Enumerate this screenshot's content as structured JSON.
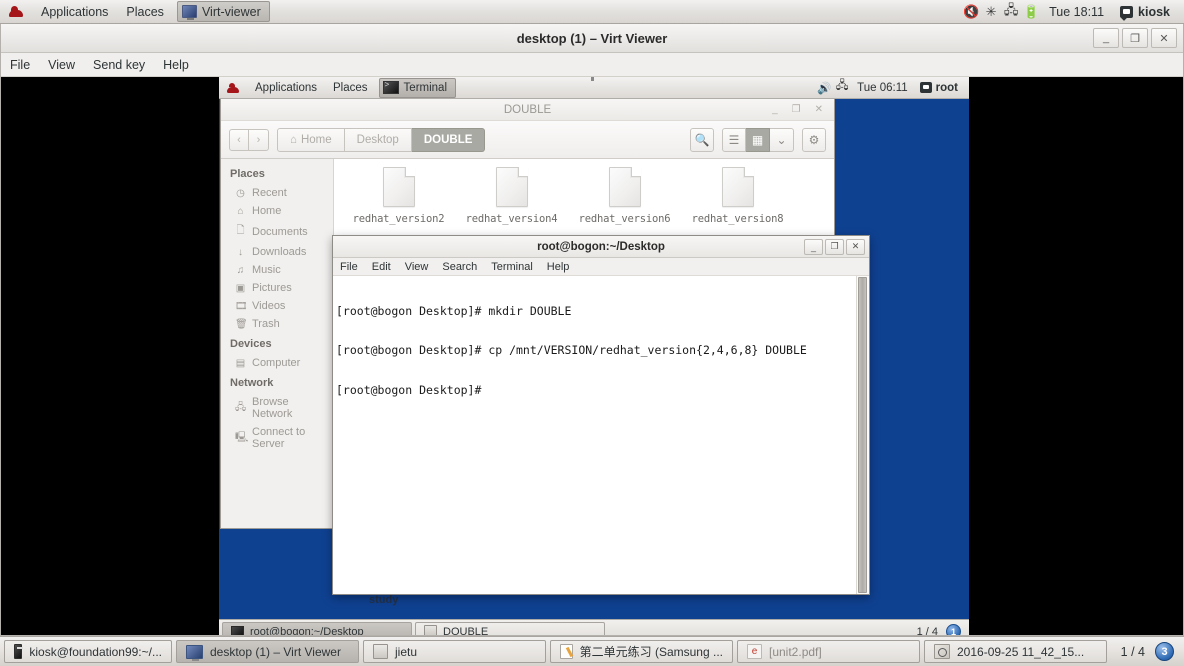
{
  "host_panel": {
    "logo": "redhat-logo",
    "applications": "Applications",
    "places": "Places",
    "active_task": "Virt-viewer",
    "tray": [
      "volume-muted-icon",
      "bluetooth-icon",
      "network-disconnected-icon",
      "battery-icon"
    ],
    "clock": "Tue 18:11",
    "user": "kiosk"
  },
  "virt_viewer": {
    "title": "desktop (1) – Virt Viewer",
    "window_buttons": {
      "minimize": "_",
      "maximize": "❐",
      "close": "✕"
    },
    "menu": [
      "File",
      "View",
      "Send key",
      "Help"
    ]
  },
  "guest_panel": {
    "applications": "Applications",
    "places": "Places",
    "active_task": "Terminal",
    "tray": [
      "volume-icon",
      "network-disconnected-icon"
    ],
    "clock": "Tue 06:11",
    "user": "root"
  },
  "file_manager": {
    "title": "DOUBLE",
    "window_buttons": {
      "minimize": "_",
      "maximize": "❐",
      "close": "✕"
    },
    "nav": {
      "back": "‹",
      "forward": "›"
    },
    "breadcrumbs": [
      {
        "label": "Home",
        "icon": "home-icon",
        "active": false
      },
      {
        "label": "Desktop",
        "icon": "",
        "active": false
      },
      {
        "label": "DOUBLE",
        "icon": "",
        "active": true
      }
    ],
    "toolbar_icons": {
      "search": "🔍",
      "list_view": "☰",
      "grid_view": "▦",
      "view_menu": "⌄",
      "settings": "⚙"
    },
    "sidebar": [
      {
        "type": "header",
        "label": "Places"
      },
      {
        "type": "item",
        "label": "Recent",
        "icon": "clock-icon"
      },
      {
        "type": "item",
        "label": "Home",
        "icon": "home-icon"
      },
      {
        "type": "item",
        "label": "Documents",
        "icon": "document-icon"
      },
      {
        "type": "item",
        "label": "Downloads",
        "icon": "download-icon"
      },
      {
        "type": "item",
        "label": "Music",
        "icon": "music-icon"
      },
      {
        "type": "item",
        "label": "Pictures",
        "icon": "camera-icon"
      },
      {
        "type": "item",
        "label": "Videos",
        "icon": "film-icon"
      },
      {
        "type": "item",
        "label": "Trash",
        "icon": "trash-icon"
      },
      {
        "type": "header",
        "label": "Devices"
      },
      {
        "type": "item",
        "label": "Computer",
        "icon": "computer-icon"
      },
      {
        "type": "header",
        "label": "Network"
      },
      {
        "type": "item",
        "label": "Browse Network",
        "icon": "network-icon"
      },
      {
        "type": "item",
        "label": "Connect to Server",
        "icon": "server-icon"
      }
    ],
    "files": [
      {
        "name": "redhat_version2",
        "icon": "document-icon"
      },
      {
        "name": "redhat_version4",
        "icon": "document-icon"
      },
      {
        "name": "redhat_version6",
        "icon": "document-icon"
      },
      {
        "name": "redhat_version8",
        "icon": "document-icon"
      }
    ]
  },
  "desktop": {
    "background_color": "#0f4191",
    "icon_label": "study"
  },
  "terminal": {
    "title": "root@bogon:~/Desktop",
    "window_buttons": {
      "minimize": "_",
      "maximize": "❐",
      "close": "✕"
    },
    "menu": [
      "File",
      "Edit",
      "View",
      "Search",
      "Terminal",
      "Help"
    ],
    "lines": [
      "[root@bogon Desktop]# mkdir DOUBLE",
      "[root@bogon Desktop]# cp /mnt/VERSION/redhat_version{2,4,6,8} DOUBLE",
      "[root@bogon Desktop]#"
    ]
  },
  "guest_taskbar": {
    "tasks": [
      {
        "label": "root@bogon:~/Desktop",
        "icon": "terminal-icon",
        "active": true
      },
      {
        "label": "DOUBLE",
        "icon": "file-manager-icon",
        "active": false
      }
    ],
    "pager": "1 / 4",
    "workspace": "1"
  },
  "host_taskbar": {
    "tasks": [
      {
        "label": "kiosk@foundation99:~/...",
        "icon": "terminal-icon",
        "active": false
      },
      {
        "label": "desktop (1) – Virt Viewer",
        "icon": "monitor-icon",
        "active": true
      },
      {
        "label": "jietu",
        "icon": "archive-icon",
        "active": false
      },
      {
        "label": "第二单元练习 (Samsung ...",
        "icon": "editor-icon",
        "active": false
      },
      {
        "label": "[unit2.pdf]",
        "icon": "pdf-icon",
        "active": false,
        "dim": true
      },
      {
        "label": "2016-09-25 11_42_15...",
        "icon": "image-viewer-icon",
        "active": false
      }
    ],
    "pager": "1 / 4",
    "workspace": "3"
  }
}
